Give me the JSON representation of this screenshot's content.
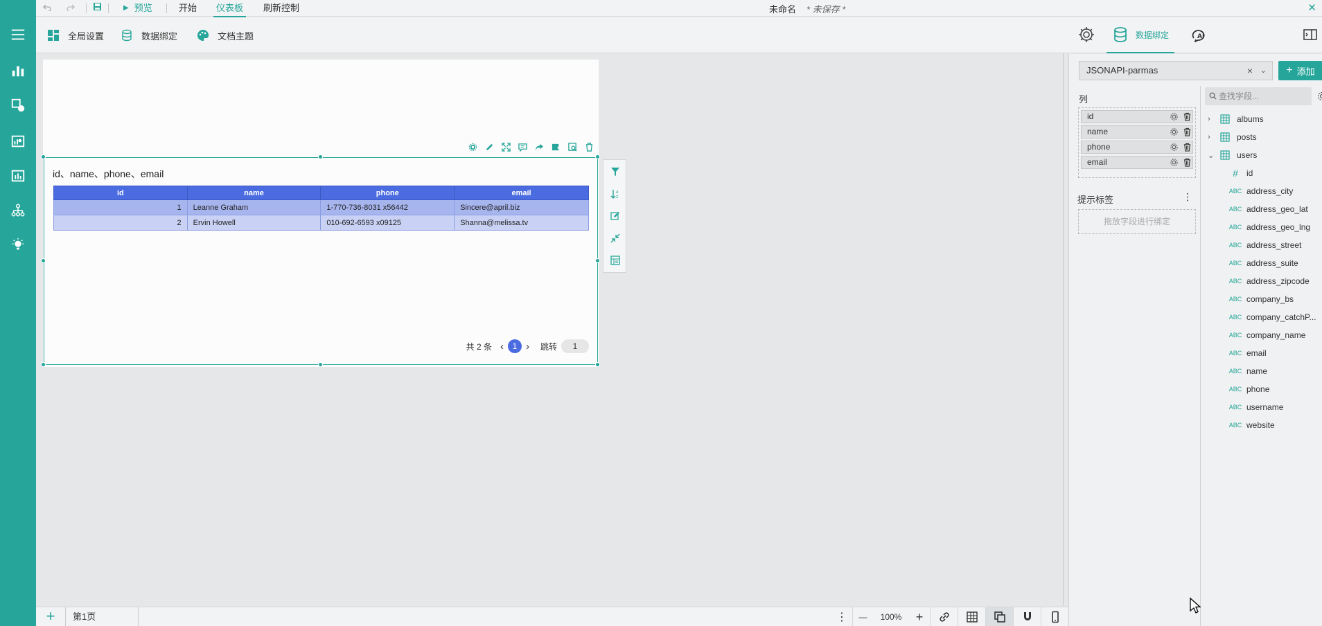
{
  "topbar": {
    "preview_label": "预览",
    "tabs": [
      {
        "label": "开始"
      },
      {
        "label": "仪表板"
      },
      {
        "label": "刷新控制"
      }
    ],
    "doc_title": "未命名",
    "doc_state": "* 未保存 *",
    "close_glyph": "✕"
  },
  "toolbar": {
    "global_settings": "全局设置",
    "data_binding": "数据绑定",
    "doc_theme": "文档主题"
  },
  "right_tabs": {
    "bind_label": "数据绑定"
  },
  "widget": {
    "title": "id、name、phone、email",
    "table": {
      "columns": [
        "id",
        "name",
        "phone",
        "email"
      ],
      "rows": [
        {
          "id": "1",
          "name": "Leanne Graham",
          "phone": "1-770-736-8031 x56442",
          "email": "Sincere@april.biz"
        },
        {
          "id": "2",
          "name": "Ervin Howell",
          "phone": "010-692-6593 x09125",
          "email": "Shanna@melissa.tv"
        }
      ],
      "header_color": "#4b6be0"
    },
    "pager": {
      "total": "共 2 条",
      "prev": "‹",
      "current": "1",
      "next": "›",
      "jump_label": "跳转",
      "jump_value": "1"
    }
  },
  "bottombar": {
    "add": "+",
    "page_tab": "第1页",
    "more": "⋮",
    "zoom_out": "—",
    "zoom": "100%",
    "zoom_in": "+"
  },
  "panel": {
    "datasource": "JSONAPI-parmas",
    "clear": "×",
    "caret": "⌄",
    "add_button": "添加",
    "columns_label": "列",
    "columns": [
      "id",
      "name",
      "phone",
      "email"
    ],
    "hint_label": "提示标签",
    "hint_more": "⋮",
    "hint_drop": "拖放字段进行绑定",
    "search_placeholder": "查找字段...",
    "tables": [
      {
        "name": "albums",
        "caret": "›"
      },
      {
        "name": "posts",
        "caret": "›"
      },
      {
        "name": "users",
        "caret": "⌄"
      }
    ],
    "fields": [
      {
        "type": "#",
        "name": "id"
      },
      {
        "type": "ABC",
        "name": "address_city"
      },
      {
        "type": "ABC",
        "name": "address_geo_lat"
      },
      {
        "type": "ABC",
        "name": "address_geo_lng"
      },
      {
        "type": "ABC",
        "name": "address_street"
      },
      {
        "type": "ABC",
        "name": "address_suite"
      },
      {
        "type": "ABC",
        "name": "address_zipcode"
      },
      {
        "type": "ABC",
        "name": "company_bs"
      },
      {
        "type": "ABC",
        "name": "company_catchP..."
      },
      {
        "type": "ABC",
        "name": "company_name"
      },
      {
        "type": "ABC",
        "name": "email"
      },
      {
        "type": "ABC",
        "name": "name"
      },
      {
        "type": "ABC",
        "name": "phone"
      },
      {
        "type": "ABC",
        "name": "username"
      },
      {
        "type": "ABC",
        "name": "website"
      }
    ]
  },
  "colors": {
    "accent": "#26a69a",
    "table_header": "#4b6be0",
    "row_odd": "#a7b5ef",
    "row_even": "#c9d2f5"
  }
}
